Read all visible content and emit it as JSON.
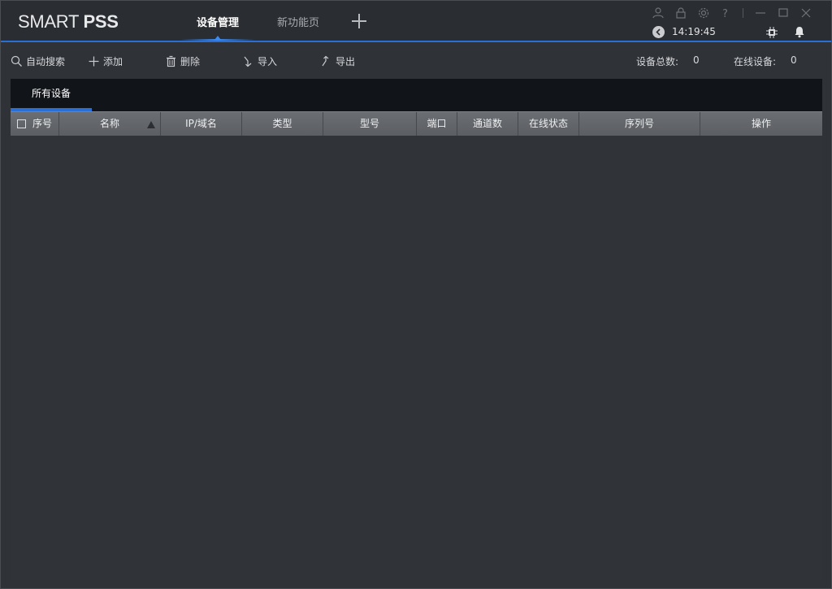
{
  "app": {
    "logo_light": "SMART ",
    "logo_bold": "PSS"
  },
  "tabs": [
    {
      "label": "设备管理",
      "active": true
    },
    {
      "label": "新功能页",
      "active": false
    }
  ],
  "status": {
    "time": "14:19:45"
  },
  "icons": {
    "user": "user-icon",
    "lock": "lock-icon",
    "settings": "gear-icon",
    "help": "help-icon",
    "minimize": "minimize-icon",
    "maximize": "maximize-icon",
    "close": "close-icon",
    "cpu": "cpu-icon",
    "bell": "bell-icon"
  },
  "toolbar": {
    "search_label": "自动搜索",
    "add_label": "添加",
    "delete_label": "删除",
    "import_label": "导入",
    "export_label": "导出",
    "total_label": "设备总数:",
    "total_value": "0",
    "online_label": "在线设备:",
    "online_value": "0"
  },
  "subtabs": [
    {
      "label": "所有设备",
      "active": true
    }
  ],
  "table": {
    "columns": [
      "序号",
      "名称",
      "IP/域名",
      "类型",
      "型号",
      "端口",
      "通道数",
      "在线状态",
      "序列号",
      "操作"
    ],
    "rows": []
  },
  "colors": {
    "accent": "#2a6fd6",
    "background": "#2f3237",
    "titlebar": "#2a2d31",
    "header": "#5f6267"
  }
}
